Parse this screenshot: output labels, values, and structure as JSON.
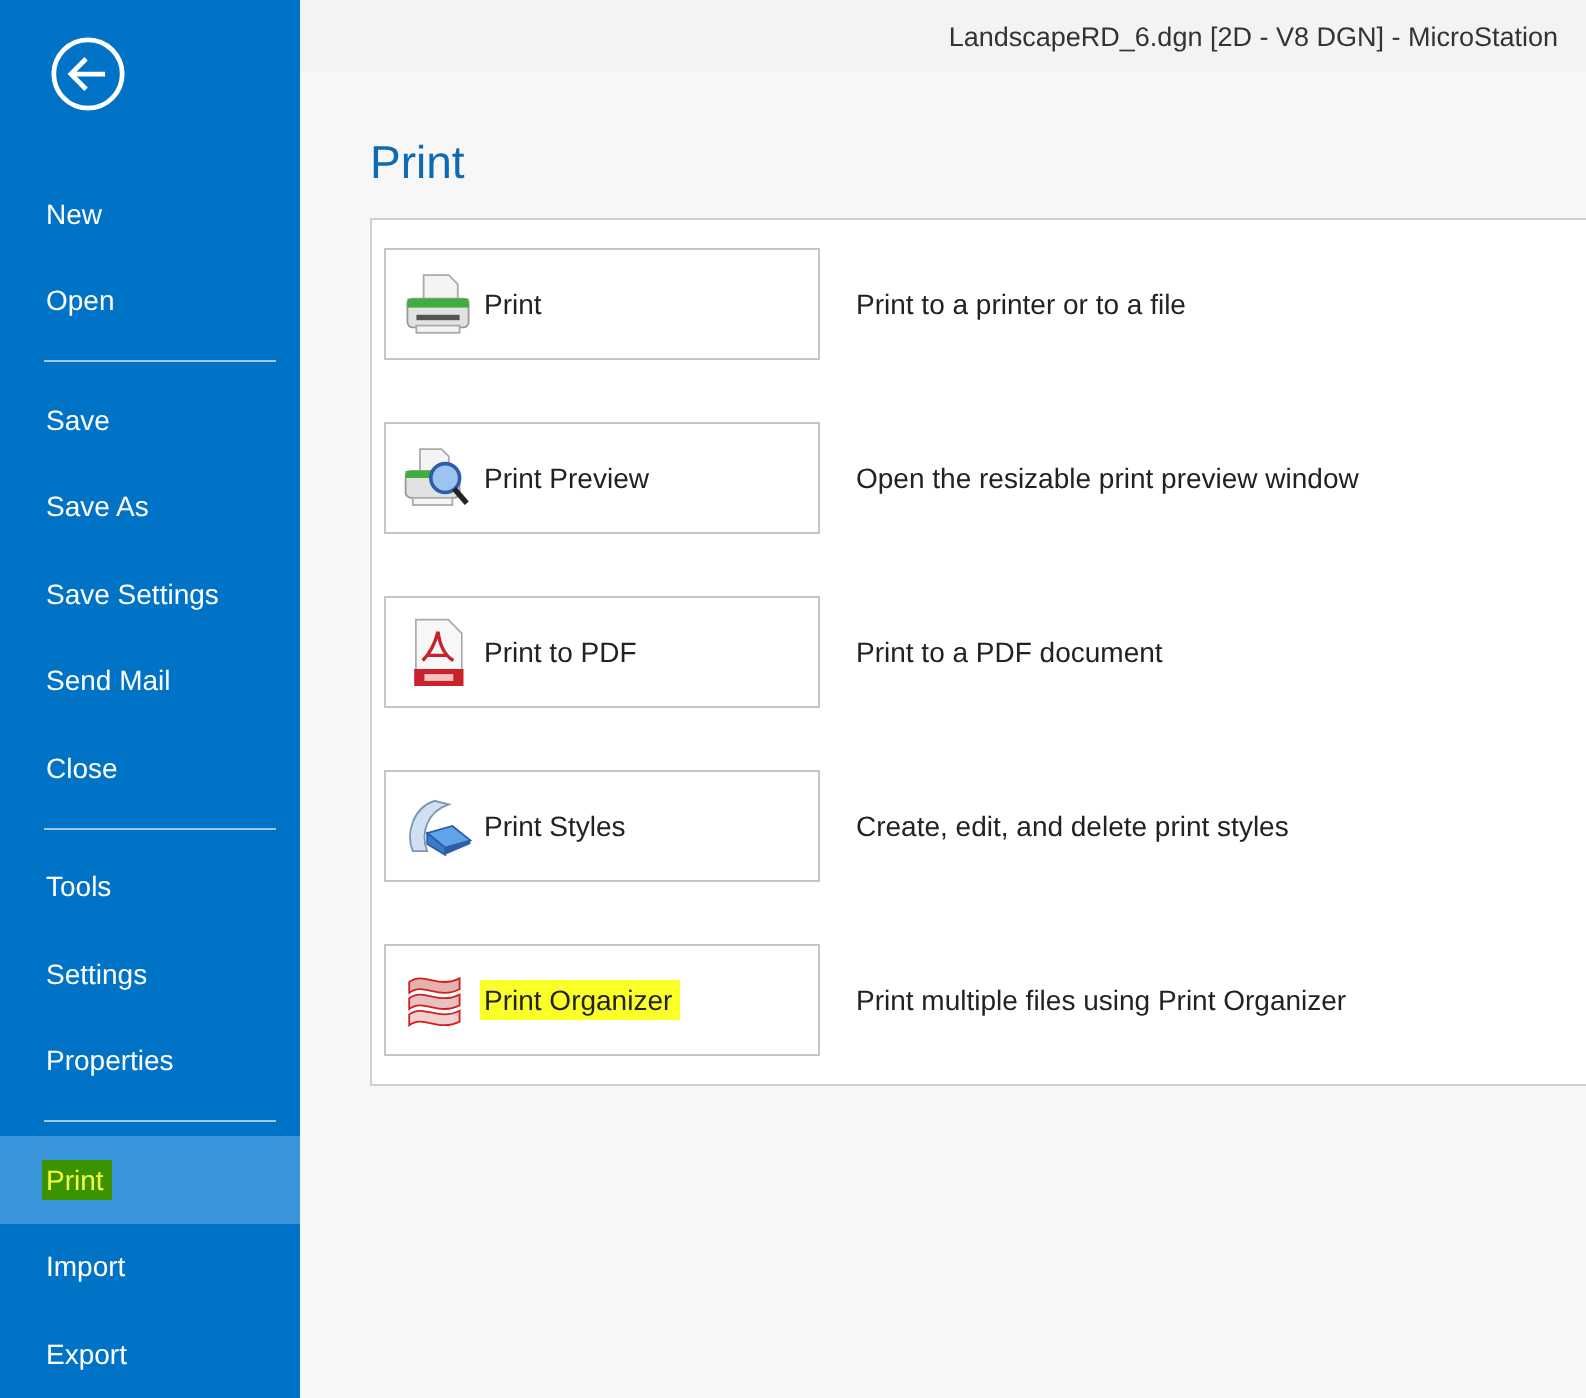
{
  "window": {
    "title": "LandscapeRD_6.dgn [2D - V8 DGN] - MicroStation"
  },
  "sidebar": {
    "items": [
      {
        "kind": "item",
        "label": "New",
        "selected": false,
        "highlighted": false
      },
      {
        "kind": "item",
        "label": "Open",
        "selected": false,
        "highlighted": false
      },
      {
        "kind": "separator"
      },
      {
        "kind": "item",
        "label": "Save",
        "selected": false,
        "highlighted": false
      },
      {
        "kind": "item",
        "label": "Save As",
        "selected": false,
        "highlighted": false
      },
      {
        "kind": "item",
        "label": "Save Settings",
        "selected": false,
        "highlighted": false
      },
      {
        "kind": "item",
        "label": "Send Mail",
        "selected": false,
        "highlighted": false
      },
      {
        "kind": "item",
        "label": "Close",
        "selected": false,
        "highlighted": false
      },
      {
        "kind": "separator"
      },
      {
        "kind": "item",
        "label": "Tools",
        "selected": false,
        "highlighted": false
      },
      {
        "kind": "item",
        "label": "Settings",
        "selected": false,
        "highlighted": false
      },
      {
        "kind": "item",
        "label": "Properties",
        "selected": false,
        "highlighted": false
      },
      {
        "kind": "separator"
      },
      {
        "kind": "item",
        "label": "Print",
        "selected": true,
        "highlighted": true
      },
      {
        "kind": "item",
        "label": "Import",
        "selected": false,
        "highlighted": false
      },
      {
        "kind": "item",
        "label": "Export",
        "selected": false,
        "highlighted": false
      }
    ]
  },
  "page": {
    "title": "Print",
    "options": [
      {
        "kind": "printer",
        "label": "Print",
        "description": "Print to a printer or to a file",
        "highlighted": false
      },
      {
        "kind": "preview",
        "label": "Print Preview",
        "description": "Open the resizable print preview window",
        "highlighted": false
      },
      {
        "kind": "pdf",
        "label": "Print to PDF",
        "description": "Print to a PDF document",
        "highlighted": false
      },
      {
        "kind": "styles",
        "label": "Print Styles",
        "description": "Create, edit, and delete print styles",
        "highlighted": false
      },
      {
        "kind": "organizer",
        "label": "Print Organizer",
        "description": "Print multiple files using Print Organizer",
        "highlighted": true
      }
    ]
  }
}
